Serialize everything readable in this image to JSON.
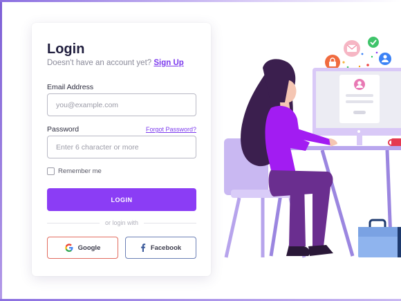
{
  "login": {
    "title": "Login",
    "subtitle_text": "Doesn't have an account yet?",
    "signup_link": "Sign Up",
    "email_label": "Email Address",
    "email_placeholder": "you@example.com",
    "password_label": "Password",
    "forgot_link": "Forgot Password?",
    "password_placeholder": "Enter 6 character or more",
    "remember_label": "Remember me",
    "login_button": "LOGIN",
    "divider_text": "or login with",
    "google_button": "Google",
    "facebook_button": "Facebook"
  },
  "colors": {
    "accent": "#8b3df5",
    "title": "#1f1d3d",
    "google_border": "#e26b5e",
    "facebook_border": "#6b7fb5"
  },
  "icons": [
    "google-icon",
    "facebook-icon",
    "lock-icon",
    "mail-icon",
    "check-icon",
    "user-icon"
  ]
}
